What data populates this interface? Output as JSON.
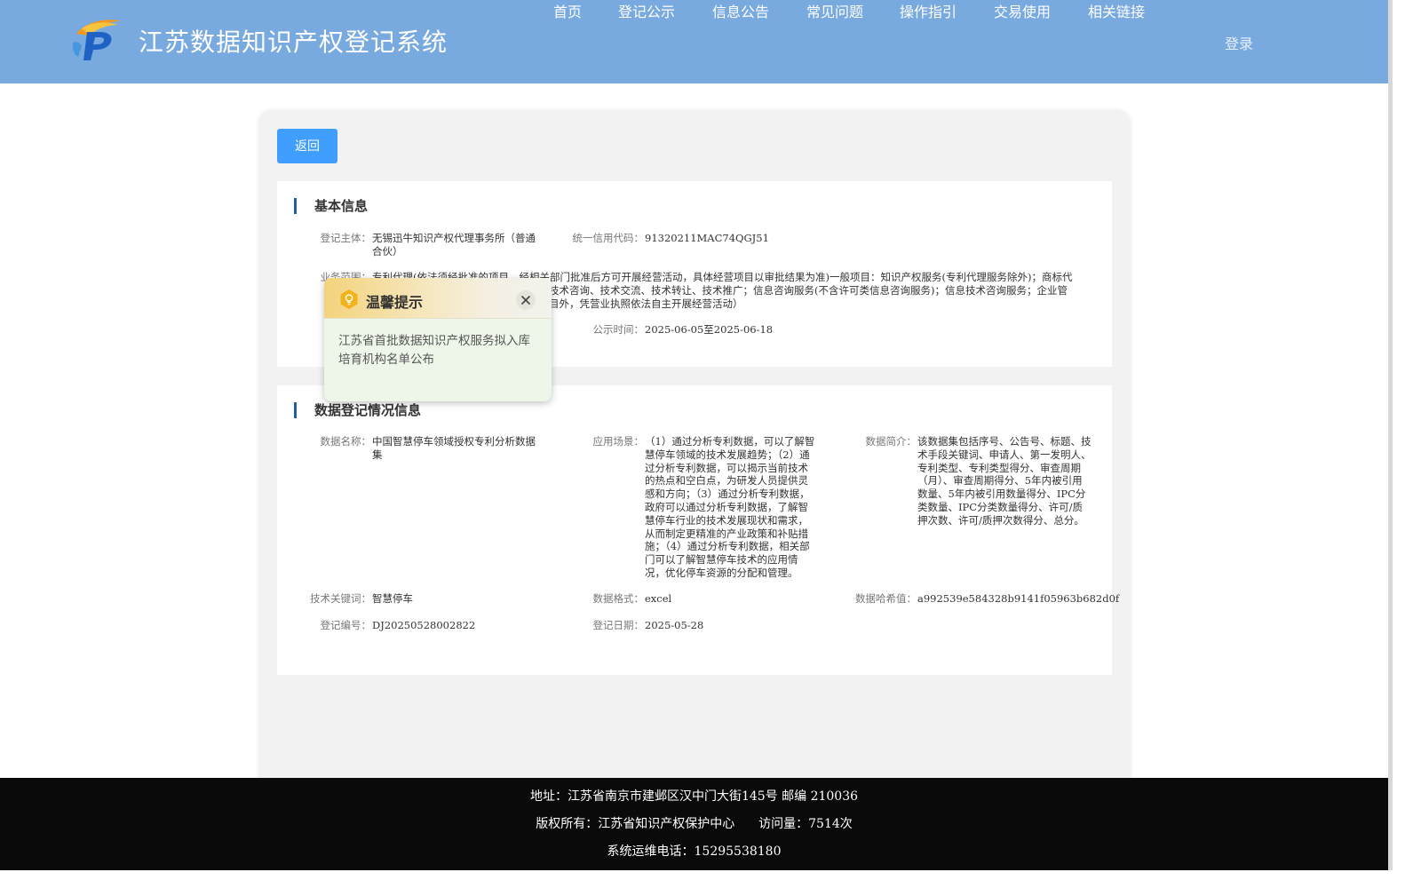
{
  "header": {
    "site_title": "江苏数据知识产权登记系统",
    "logo": "jiangsu-ip-logo",
    "nav": [
      "首页",
      "登记公示",
      "信息公告",
      "常见问题",
      "操作指引",
      "交易使用",
      "相关链接"
    ],
    "login_label": "登录"
  },
  "toolbar": {
    "back_label": "返回"
  },
  "basic_info": {
    "title": "基本信息",
    "subject_label": "登记主体：",
    "subject_value": "无锡迅牛知识产权代理事务所（普通合伙）",
    "credit_code_label": "统一信用代码：",
    "credit_code_value": "91320211MAC74QGJ51",
    "business_scope_label": "业务范围：",
    "business_scope_line1": "专利代理(依法须经批准的项目，经相关部门批准后方可开展经营活动，具体经营项目以审批结果为准)一般项目：知识产权服务(专利代理服务除外)；商标代",
    "business_scope_line2": "技术咨询、技术交流、技术转让、技术推广；信息咨询服务(不含许可类信息咨询服务)；信息技术咨询服务；企业管",
    "business_scope_line3": "目外，凭营业执照依法自主开展经营活动）",
    "publicity_time_label": "公示时间：",
    "publicity_time_value": "2025-06-05至2025-06-18"
  },
  "data_info": {
    "title": "数据登记情况信息",
    "name_label": "数据名称：",
    "name_value": "中国智慧停车领域授权专利分析数据集",
    "scenario_label": "应用场景：",
    "scenario_value": "（1）通过分析专利数据，可以了解智慧停车领域的技术发展趋势；（2）通过分析专利数据，可以揭示当前技术的热点和空白点，为研发人员提供灵感和方向；（3）通过分析专利数据，政府可以通过分析专利数据，了解智慧停车行业的技术发展现状和需求，从而制定更精准的产业政策和补贴措施；（4）通过分析专利数据，相关部门可以了解智慧停车技术的应用情况，优化停车资源的分配和管理。",
    "intro_label": "数据简介：",
    "intro_value": "该数据集包括序号、公告号、标题、技术手段关键词、申请人、第一发明人、专利类型、专利类型得分、审查周期（月）、审查周期得分、5年内被引用数量、5年内被引用数量得分、IPC分类数量、IPC分类数量得分、许可/质押次数、许可/质押次数得分、总分。",
    "keyword_label": "技术关键词：",
    "keyword_value": "智慧停车",
    "format_label": "数据格式：",
    "format_value": "excel",
    "hash_label": "数据哈希值：",
    "hash_value": "a992539e584328b9141f05963b682d0f",
    "reg_no_label": "登记编号：",
    "reg_no_value": "DJ20250528002822",
    "reg_date_label": "登记日期：",
    "reg_date_value": "2025-05-28"
  },
  "popup": {
    "icon": "lightbulb-icon",
    "title": "温馨提示",
    "body": "江苏省首批数据知识产权服务拟入库培育机构名单公布"
  },
  "footer": {
    "address": "地址：江苏省南京市建邺区汉中门大街145号 邮编 210036",
    "copyright": "版权所有：江苏省知识产权保护中心",
    "visits": "访问量：7514次",
    "phone": "系统运维电话：15295538180"
  },
  "colors": {
    "header_bg": "#79aadf",
    "button_blue": "#409eff",
    "section_bar": "#1f5da8",
    "footer_bg": "#0a0a0a",
    "popup_header": "#f3d37c"
  }
}
